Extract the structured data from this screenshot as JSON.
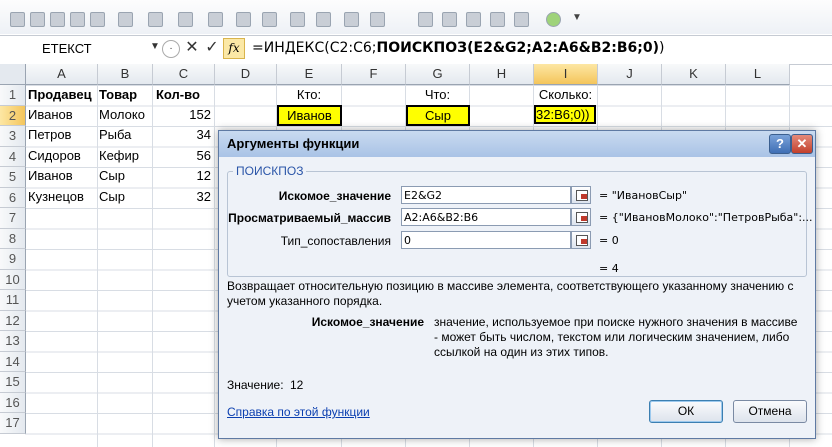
{
  "formula_bar": {
    "name_box": "ЕТЕКСТ",
    "cancel_symbol": "✕",
    "enter_symbol": "✓",
    "fx_label": "fx",
    "formula_prefix": "=ИНДЕКС(C2:C6;",
    "formula_bold": "ПОИСКПОЗ(E2&G2;A2:A6&B2:B6;0)",
    "formula_suffix": ")"
  },
  "columns": [
    "A",
    "B",
    "C",
    "D",
    "E",
    "F",
    "G",
    "H",
    "I",
    "J",
    "K",
    "L"
  ],
  "rows": [
    "1",
    "2",
    "3",
    "4",
    "5",
    "6",
    "7",
    "8",
    "9",
    "10",
    "11",
    "12",
    "13",
    "14",
    "15",
    "16",
    "17"
  ],
  "table": {
    "headers": [
      "Продавец",
      "Товар",
      "Кол-во"
    ],
    "rows": [
      [
        "Иванов",
        "Молоко",
        "152"
      ],
      [
        "Петров",
        "Рыба",
        "34"
      ],
      [
        "Сидоров",
        "Кефир",
        "56"
      ],
      [
        "Иванов",
        "Сыр",
        "12"
      ],
      [
        "Кузнецов",
        "Сыр",
        "32"
      ]
    ]
  },
  "lookup": {
    "who_label": "Кто:",
    "who_value": "Иванов",
    "what_label": "Что:",
    "what_value": "Сыр",
    "count_label": "Сколько:",
    "count_value": "32:B6;0))"
  },
  "dialog": {
    "title": "Аргументы функции",
    "help_symbol": "?",
    "close_symbol": "✕",
    "function_name": "ПОИСКПОЗ",
    "args": [
      {
        "label": "Искомое_значение",
        "value": "E2&G2",
        "result": "=  \"ИвановСыр\""
      },
      {
        "label": "Просматриваемый_массив",
        "value": "A2:A6&B2:B6",
        "result": "=  {\"ИвановМолоко\":\"ПетровРыба\":..."
      },
      {
        "label": "Тип_сопоставления",
        "value": "0",
        "result": "=  0"
      }
    ],
    "overall_result": "=  4",
    "description": "Возвращает относительную позицию в массиве элемента, соответствующего указанному значению с учетом указанного порядка.",
    "arg_help_name": "Искомое_значение",
    "arg_help_text": "значение, используемое при поиске нужного значения в массиве - может быть числом, текстом или логическим значением, либо ссылкой на один из этих типов.",
    "value_label": "Значение:",
    "value": "12",
    "help_link": "Справка по этой функции",
    "ok_label": "ОК",
    "cancel_label": "Отмена"
  }
}
